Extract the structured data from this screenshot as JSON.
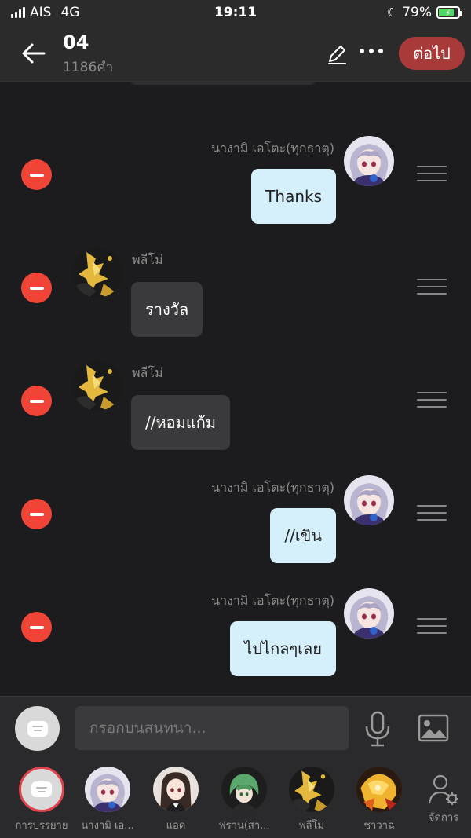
{
  "status_bar": {
    "carrier": "AIS",
    "network": "4G",
    "time": "19:11",
    "battery": "79%",
    "battery_level": 0.79
  },
  "header": {
    "title": "04",
    "word_count": "1186คำ",
    "next_label": "ต่อไป"
  },
  "messages": [
    {
      "side": "right",
      "name": "นางามิ เอโตะ(ทุกธาตุ)",
      "text": "Thanks",
      "avatar": "nagami-avatar"
    },
    {
      "side": "left",
      "name": "พลีโม่",
      "text": "รางวัล",
      "avatar": "plimo-avatar"
    },
    {
      "side": "left",
      "name": "พลีโม่",
      "text": "//หอมแก้ม",
      "avatar": "plimo-avatar"
    },
    {
      "side": "right",
      "name": "นางามิ เอโตะ(ทุกธาตุ)",
      "text": "//เขิน",
      "avatar": "nagami-avatar"
    },
    {
      "side": "right",
      "name": "นางามิ เอโตะ(ทุกธาตุ)",
      "text": "ไปไกลๆเลย",
      "avatar": "nagami-avatar"
    }
  ],
  "input": {
    "placeholder": "กรอกบนสนทนา..."
  },
  "characters": [
    {
      "label": "การบรรยาย",
      "kind": "narration"
    },
    {
      "label": "นางามิ เอ...",
      "kind": "nagami"
    },
    {
      "label": "แอด",
      "kind": "ad"
    },
    {
      "label": "ฟราน(สา...",
      "kind": "fran"
    },
    {
      "label": "พลีโม่",
      "kind": "plimo"
    },
    {
      "label": "ชาวาฉ",
      "kind": "chawa"
    },
    {
      "label": "จัดการ",
      "kind": "manage"
    }
  ],
  "colors": {
    "accent_red": "#a83a3a",
    "delete_red": "#f04437",
    "my_bubble": "#d5f0fb",
    "other_bubble": "#3a3a3c",
    "battery_green": "#4cd964"
  }
}
